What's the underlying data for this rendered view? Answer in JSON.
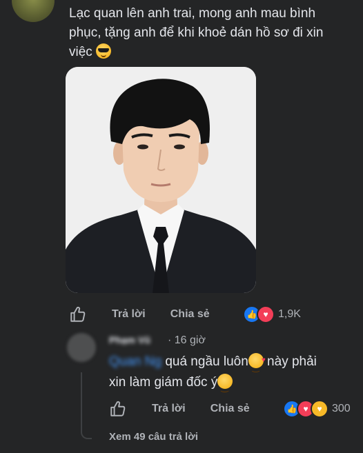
{
  "comment": {
    "text": "Lạc quan lên anh trai, mong anh mau bình phục, tặng anh để khi khoẻ dán hồ sơ đi xin việc",
    "emoji": "smiling-face-with-sunglasses"
  },
  "comment_actions": {
    "reply_label": "Trả lời",
    "share_label": "Chia sẻ",
    "reaction_count": "1,9K"
  },
  "reply": {
    "author": "Phạm Vũ",
    "separator": "·",
    "time": "16 giờ",
    "mention": "Quan Ng",
    "text_part1": " quá ngầu luôn",
    "emoji1": "smiling-face-with-hearts",
    "text_part2": " này phải xin làm giám đốc ý",
    "emoji2": "smiling-face",
    "reply_label": "Trả lời",
    "share_label": "Chia sẻ",
    "reaction_count": "300"
  },
  "view_more_replies": "Xem 49 câu trả lời",
  "colors": {
    "background": "#242526",
    "text": "#e4e6eb",
    "muted": "#b0b3b8",
    "like_blue": "#1877f2",
    "love_red": "#f33e58"
  }
}
